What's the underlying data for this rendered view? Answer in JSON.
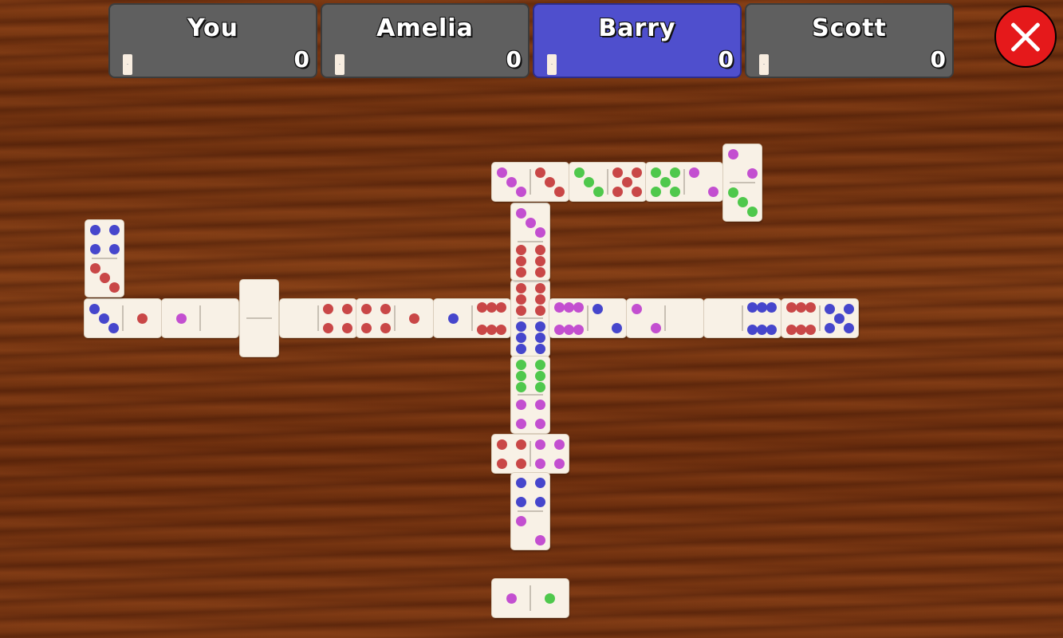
{
  "players": [
    {
      "name": "You",
      "score": "0",
      "active": false
    },
    {
      "name": "Amelia",
      "score": "0",
      "active": false
    },
    {
      "name": "Barry",
      "score": "0",
      "active": true
    },
    {
      "name": "Scott",
      "score": "0",
      "active": false
    }
  ],
  "close_button": {
    "icon": "close-icon",
    "label": "Close game"
  },
  "colors": {
    "wood": "#6f310f",
    "panel": "#5f5f5f",
    "active_panel": "#4f4fcd",
    "close": "#e5191b",
    "tile_face": "#f8f1e6",
    "pip_red": "#c94747",
    "pip_blue": "#4646cc",
    "pip_magenta": "#c34fd0",
    "pip_green": "#4fc84c"
  },
  "board": {
    "tiles": [
      {
        "id": "t1",
        "a": {
          "pips": 3,
          "color": "blue"
        },
        "b": {
          "pips": 1,
          "color": "red"
        }
      },
      {
        "id": "t2",
        "a": {
          "pips": 1,
          "color": "magenta"
        },
        "b": {
          "pips": 0,
          "color": "none"
        }
      },
      {
        "id": "t3",
        "a": {
          "pips": 0,
          "color": "none"
        },
        "b": {
          "pips": 0,
          "color": "none"
        }
      },
      {
        "id": "t4",
        "a": {
          "pips": 0,
          "color": "none"
        },
        "b": {
          "pips": 4,
          "color": "red"
        }
      },
      {
        "id": "t5",
        "a": {
          "pips": 4,
          "color": "red"
        },
        "b": {
          "pips": 1,
          "color": "red"
        }
      },
      {
        "id": "t6",
        "a": {
          "pips": 1,
          "color": "blue"
        },
        "b": {
          "pips": 6,
          "color": "red"
        }
      },
      {
        "id": "t7",
        "a": {
          "pips": 6,
          "color": "red"
        },
        "b": {
          "pips": 6,
          "color": "blue"
        }
      },
      {
        "id": "t8",
        "a": {
          "pips": 6,
          "color": "magenta"
        },
        "b": {
          "pips": 2,
          "color": "blue"
        }
      },
      {
        "id": "t9",
        "a": {
          "pips": 2,
          "color": "magenta"
        },
        "b": {
          "pips": 0,
          "color": "none"
        }
      },
      {
        "id": "t10",
        "a": {
          "pips": 0,
          "color": "none"
        },
        "b": {
          "pips": 6,
          "color": "blue"
        }
      },
      {
        "id": "t11",
        "a": {
          "pips": 6,
          "color": "red"
        },
        "b": {
          "pips": 5,
          "color": "blue"
        }
      },
      {
        "id": "t12",
        "a": {
          "pips": 4,
          "color": "blue"
        },
        "b": {
          "pips": 3,
          "color": "red"
        }
      },
      {
        "id": "t13",
        "a": {
          "pips": 3,
          "color": "magenta"
        },
        "b": {
          "pips": 6,
          "color": "red"
        }
      },
      {
        "id": "t14",
        "a": {
          "pips": 3,
          "color": "magenta"
        },
        "b": {
          "pips": 3,
          "color": "red"
        }
      },
      {
        "id": "t15",
        "a": {
          "pips": 3,
          "color": "green"
        },
        "b": {
          "pips": 5,
          "color": "red"
        }
      },
      {
        "id": "t16",
        "a": {
          "pips": 5,
          "color": "green"
        },
        "b": {
          "pips": 2,
          "color": "magenta"
        }
      },
      {
        "id": "t17",
        "a": {
          "pips": 2,
          "color": "magenta"
        },
        "b": {
          "pips": 3,
          "color": "green"
        }
      },
      {
        "id": "t18",
        "a": {
          "pips": 6,
          "color": "green"
        },
        "b": {
          "pips": 4,
          "color": "magenta"
        }
      },
      {
        "id": "t19",
        "a": {
          "pips": 4,
          "color": "red"
        },
        "b": {
          "pips": 4,
          "color": "magenta"
        }
      },
      {
        "id": "t20",
        "a": {
          "pips": 4,
          "color": "blue"
        },
        "b": {
          "pips": 2,
          "color": "magenta"
        }
      },
      {
        "id": "t21",
        "a": {
          "pips": 1,
          "color": "magenta"
        },
        "b": {
          "pips": 1,
          "color": "green"
        }
      }
    ]
  }
}
